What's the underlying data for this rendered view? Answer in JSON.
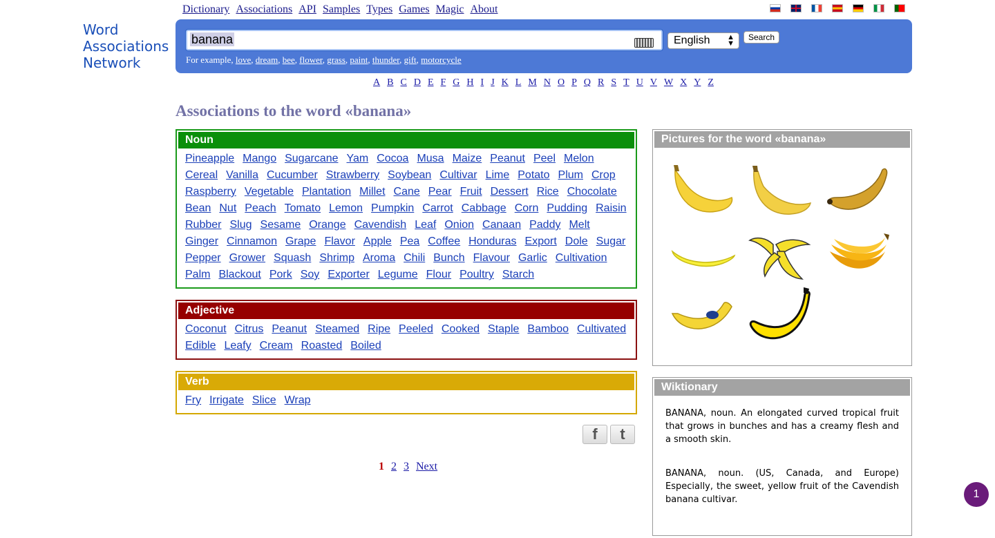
{
  "nav": [
    "Dictionary",
    "Associations",
    "API",
    "Samples",
    "Types",
    "Games",
    "Magic",
    "About"
  ],
  "flags": [
    {
      "name": "flag-russia-icon",
      "colors": [
        "#ffffff",
        "#0039a6",
        "#d52b1e"
      ]
    },
    {
      "name": "flag-uk-icon",
      "colors": [
        "#012169",
        "#ffffff",
        "#c8102e"
      ]
    },
    {
      "name": "flag-france-icon",
      "colors": [
        "#0055a4",
        "#ffffff",
        "#ef4135"
      ]
    },
    {
      "name": "flag-spain-icon",
      "colors": [
        "#c60b1e",
        "#ffc400",
        "#c60b1e"
      ]
    },
    {
      "name": "flag-germany-icon",
      "colors": [
        "#000000",
        "#dd0000",
        "#ffce00"
      ]
    },
    {
      "name": "flag-italy-icon",
      "colors": [
        "#009246",
        "#ffffff",
        "#ce2b37"
      ]
    },
    {
      "name": "flag-portugal-icon",
      "colors": [
        "#006600",
        "#ff0000",
        "#ff0000"
      ]
    }
  ],
  "logo": {
    "line1": "Word",
    "line2": "Associations",
    "line3": "Network"
  },
  "search": {
    "value": "banana",
    "language": "English",
    "button": "Search",
    "examples_prefix": "For example, ",
    "examples": [
      "love",
      "dream",
      "bee",
      "flower",
      "grass",
      "paint",
      "thunder",
      "gift",
      "motorcycle"
    ]
  },
  "alphabet": [
    "A",
    "B",
    "C",
    "D",
    "E",
    "F",
    "G",
    "H",
    "I",
    "J",
    "K",
    "L",
    "M",
    "N",
    "O",
    "P",
    "Q",
    "R",
    "S",
    "T",
    "U",
    "V",
    "W",
    "X",
    "Y",
    "Z"
  ],
  "title": "Associations to the word «banana»",
  "noun": {
    "label": "Noun",
    "words": [
      "Pineapple",
      "Mango",
      "Sugarcane",
      "Yam",
      "Cocoa",
      "Musa",
      "Maize",
      "Peanut",
      "Peel",
      "Melon",
      "Cereal",
      "Vanilla",
      "Cucumber",
      "Strawberry",
      "Soybean",
      "Cultivar",
      "Lime",
      "Potato",
      "Plum",
      "Crop",
      "Raspberry",
      "Vegetable",
      "Plantation",
      "Millet",
      "Cane",
      "Pear",
      "Fruit",
      "Dessert",
      "Rice",
      "Chocolate",
      "Bean",
      "Nut",
      "Peach",
      "Tomato",
      "Lemon",
      "Pumpkin",
      "Carrot",
      "Cabbage",
      "Corn",
      "Pudding",
      "Raisin",
      "Rubber",
      "Slug",
      "Sesame",
      "Orange",
      "Cavendish",
      "Leaf",
      "Onion",
      "Canaan",
      "Paddy",
      "Melt",
      "Ginger",
      "Cinnamon",
      "Grape",
      "Flavor",
      "Apple",
      "Pea",
      "Coffee",
      "Honduras",
      "Export",
      "Dole",
      "Sugar",
      "Pepper",
      "Grower",
      "Squash",
      "Shrimp",
      "Aroma",
      "Chili",
      "Bunch",
      "Flavour",
      "Garlic",
      "Cultivation",
      "Palm",
      "Blackout",
      "Pork",
      "Soy",
      "Exporter",
      "Legume",
      "Flour",
      "Poultry",
      "Starch"
    ]
  },
  "adjective": {
    "label": "Adjective",
    "words": [
      "Coconut",
      "Citrus",
      "Peanut",
      "Steamed",
      "Ripe",
      "Peeled",
      "Cooked",
      "Staple",
      "Bamboo",
      "Cultivated",
      "Edible",
      "Leafy",
      "Cream",
      "Roasted",
      "Boiled"
    ]
  },
  "verb": {
    "label": "Verb",
    "words": [
      "Fry",
      "Irrigate",
      "Slice",
      "Wrap"
    ]
  },
  "social": {
    "facebook": "f",
    "twitter": "t"
  },
  "pagination": {
    "current": "1",
    "pages": [
      "2",
      "3"
    ],
    "next": "Next"
  },
  "pictures": {
    "title": "Pictures for the word «banana»",
    "count": 8
  },
  "wiktionary": {
    "title": "Wiktionary",
    "entries": [
      "BANANA, noun. An elongated curved tropical fruit that grows in bunches and has a creamy flesh and a smooth skin.",
      "BANANA, noun. (US, Canada, and Europe) Especially, the sweet, yellow fruit of the Cavendish banana cultivar."
    ]
  },
  "notification": "1",
  "colors": {
    "noun": "#0a8f0a",
    "adjective": "#960000",
    "verb": "#d9aa06",
    "search_panel": "#4d79d6",
    "title": "#7272a6"
  }
}
